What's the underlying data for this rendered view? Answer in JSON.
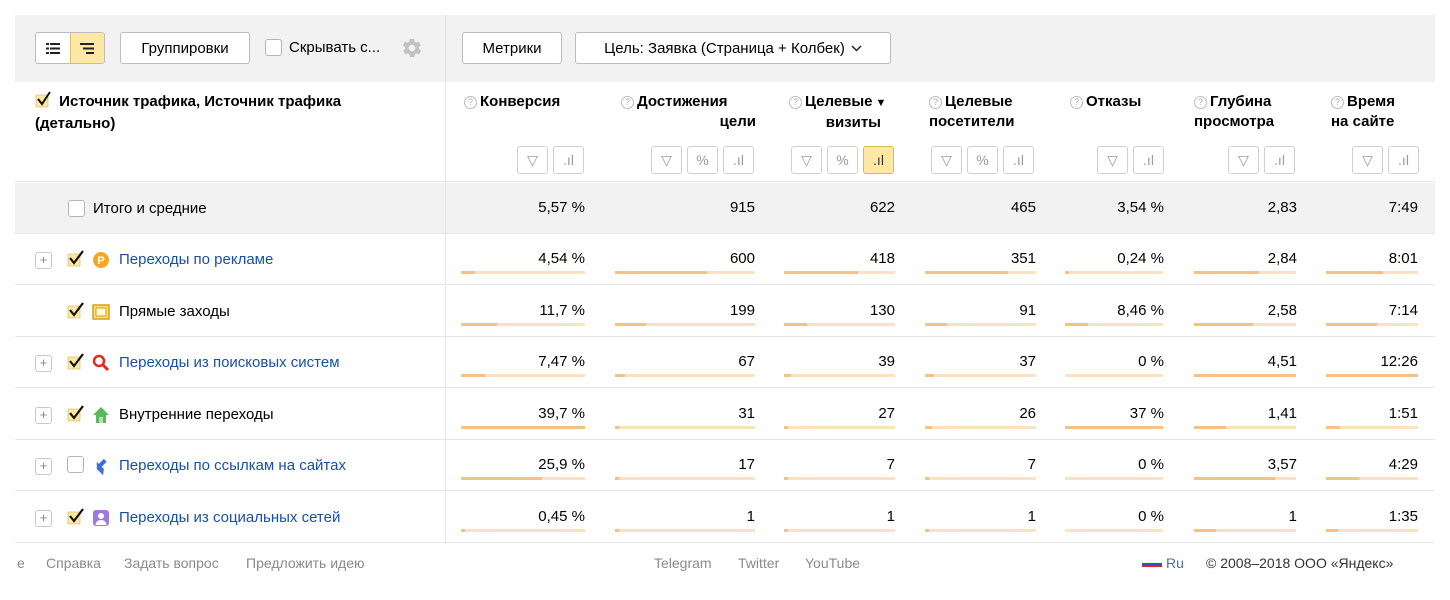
{
  "toolbar": {
    "groupings_label": "Группировки",
    "hide_label": "Скрывать с...",
    "metrics_label": "Метрики",
    "goal_label": "Цель: Заявка (Страница + Колбек)"
  },
  "table": {
    "dimension_title": "Источник трафика, Источник трафика (детально)",
    "columns": [
      {
        "label": "Конверсия"
      },
      {
        "label": "Достижения цели"
      },
      {
        "label": "Целевые визиты",
        "sorted": "desc"
      },
      {
        "label": "Целевые посетители"
      },
      {
        "label": "Отказы"
      },
      {
        "label": "Глубина просмотра"
      },
      {
        "label": "Время на сайте"
      }
    ],
    "total": {
      "label": "Итого и средние",
      "values": [
        "5,57 %",
        "915",
        "622",
        "465",
        "3,54 %",
        "2,83",
        "7:49"
      ]
    },
    "rows": [
      {
        "label": "Переходы по рекламе",
        "checked": true,
        "link": true,
        "icon": "ad-icon",
        "values": [
          "4,54 %",
          "600",
          "418",
          "351",
          "0,24 %",
          "2,84",
          "8:01"
        ],
        "fractions": [
          0.11,
          0.66,
          0.67,
          0.75,
          0.03,
          0.64,
          0.62
        ]
      },
      {
        "label": "Прямые заходы",
        "checked": true,
        "link": false,
        "icon": "direct-icon",
        "values": [
          "11,7 %",
          "199",
          "130",
          "91",
          "8,46 %",
          "2,58",
          "7:14"
        ],
        "fractions": [
          0.29,
          0.22,
          0.21,
          0.2,
          0.23,
          0.58,
          0.55
        ]
      },
      {
        "label": "Переходы из поисковых систем",
        "checked": true,
        "link": true,
        "icon": "search-icon",
        "values": [
          "7,47 %",
          "67",
          "39",
          "37",
          "0 %",
          "4,51",
          "12:26"
        ],
        "fractions": [
          0.19,
          0.07,
          0.06,
          0.08,
          0,
          1,
          1
        ]
      },
      {
        "label": "Внутренние переходы",
        "checked": true,
        "link": false,
        "icon": "home-icon",
        "values": [
          "39,7 %",
          "31",
          "27",
          "26",
          "37 %",
          "1,41",
          "1:51"
        ],
        "fractions": [
          1,
          0.03,
          0.04,
          0.06,
          1,
          0.31,
          0.15
        ]
      },
      {
        "label": "Переходы по ссылкам на сайтах",
        "checked": false,
        "link": true,
        "icon": "link-arrow-icon",
        "values": [
          "25,9 %",
          "17",
          "7",
          "7",
          "0 %",
          "3,57",
          "4:29"
        ],
        "fractions": [
          0.65,
          0.02,
          0.01,
          0.02,
          0,
          0.79,
          0.36
        ]
      },
      {
        "label": "Переходы из социальных сетей",
        "checked": true,
        "link": true,
        "icon": "social-icon",
        "values": [
          "0,45 %",
          "1",
          "1",
          "1",
          "0 %",
          "1",
          "1:35"
        ],
        "fractions": [
          0.01,
          0.005,
          0.005,
          0.005,
          0,
          0.22,
          0.13
        ]
      }
    ]
  },
  "footer": {
    "left_cut": "е",
    "help": "Справка",
    "ask": "Задать вопрос",
    "idea": "Предложить идею",
    "telegram": "Telegram",
    "twitter": "Twitter",
    "youtube": "YouTube",
    "lang": "Ru",
    "copyright": "© 2008–2018 ООО «Яндекс»"
  },
  "colors": {
    "accent_yellow": "#ffe8a3",
    "link_blue": "#1a4fa8",
    "bar_track": "#fbe2c0",
    "bar_fill": "#f6c182"
  }
}
